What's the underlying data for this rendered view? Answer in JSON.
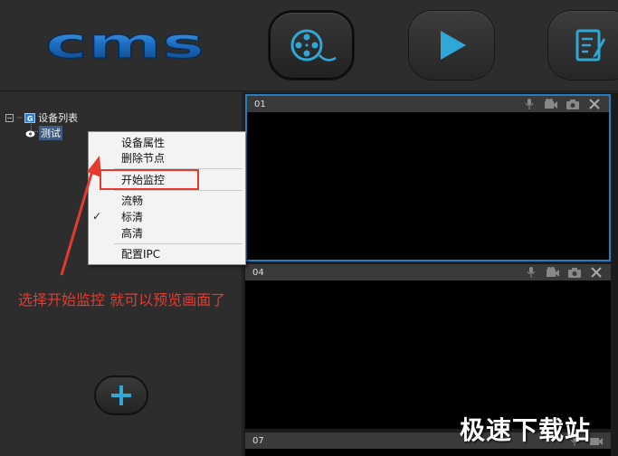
{
  "app": {
    "logo_text": "cms"
  },
  "toolbar": {
    "buttons": [
      {
        "icon": "film-reel-icon",
        "active": true
      },
      {
        "icon": "play-icon",
        "active": false
      },
      {
        "icon": "edit-document-icon",
        "active": false
      }
    ]
  },
  "tree": {
    "root_badge": "G",
    "root_label": "设备列表",
    "child_label": "测试"
  },
  "context_menu": {
    "items": [
      {
        "label": "设备属性"
      },
      {
        "label": "删除节点"
      },
      {
        "label": "开始监控"
      },
      {
        "label": "流畅"
      },
      {
        "label": "标清",
        "checked": true
      },
      {
        "label": "高清"
      },
      {
        "label": "配置IPC"
      }
    ]
  },
  "annotation": {
    "text": "选择开始监控 就可以预览画面了"
  },
  "video_panels": [
    {
      "title": "01"
    },
    {
      "title": "04"
    },
    {
      "title": "07"
    }
  ],
  "watermark": {
    "text": "极速下载站"
  },
  "colors": {
    "accent_blue": "#1e7fc2",
    "annotation_red": "#e53a2e",
    "icon_cyan": "#2fa8d8"
  }
}
